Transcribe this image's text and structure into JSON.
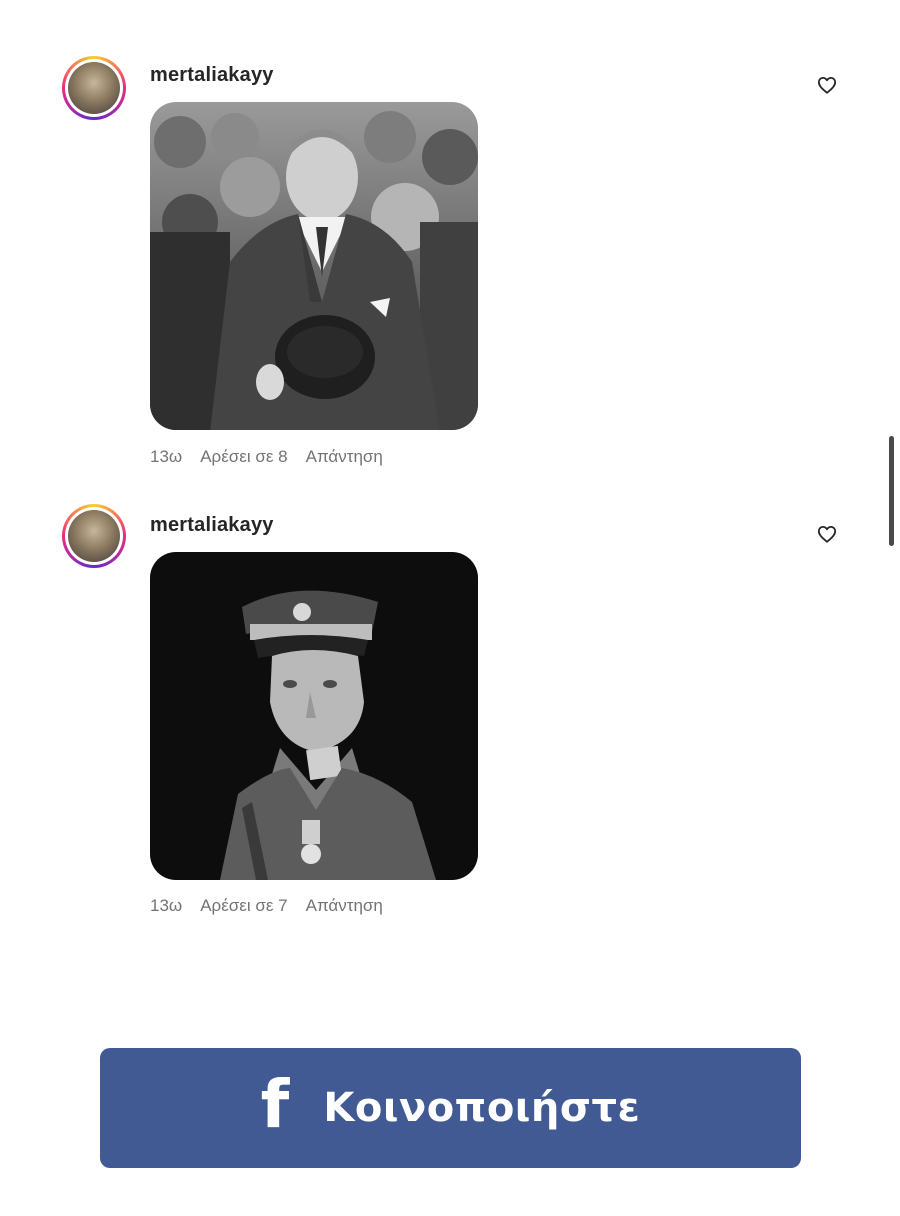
{
  "comments": [
    {
      "username": "mertaliakayy",
      "time": "13ω",
      "likes": "Αρέσει σε 8",
      "reply": "Απάντηση",
      "photo_icon": "photo-crowd-man-holding-hat"
    },
    {
      "username": "mertaliakayy",
      "time": "13ω",
      "likes": "Αρέσει σε 7",
      "reply": "Απάντηση",
      "photo_icon": "photo-officer-portrait"
    }
  ],
  "share": {
    "icon": "facebook-f-icon",
    "label": "Κοινοποιήστε",
    "glyph": "f",
    "color": "#415a94"
  }
}
